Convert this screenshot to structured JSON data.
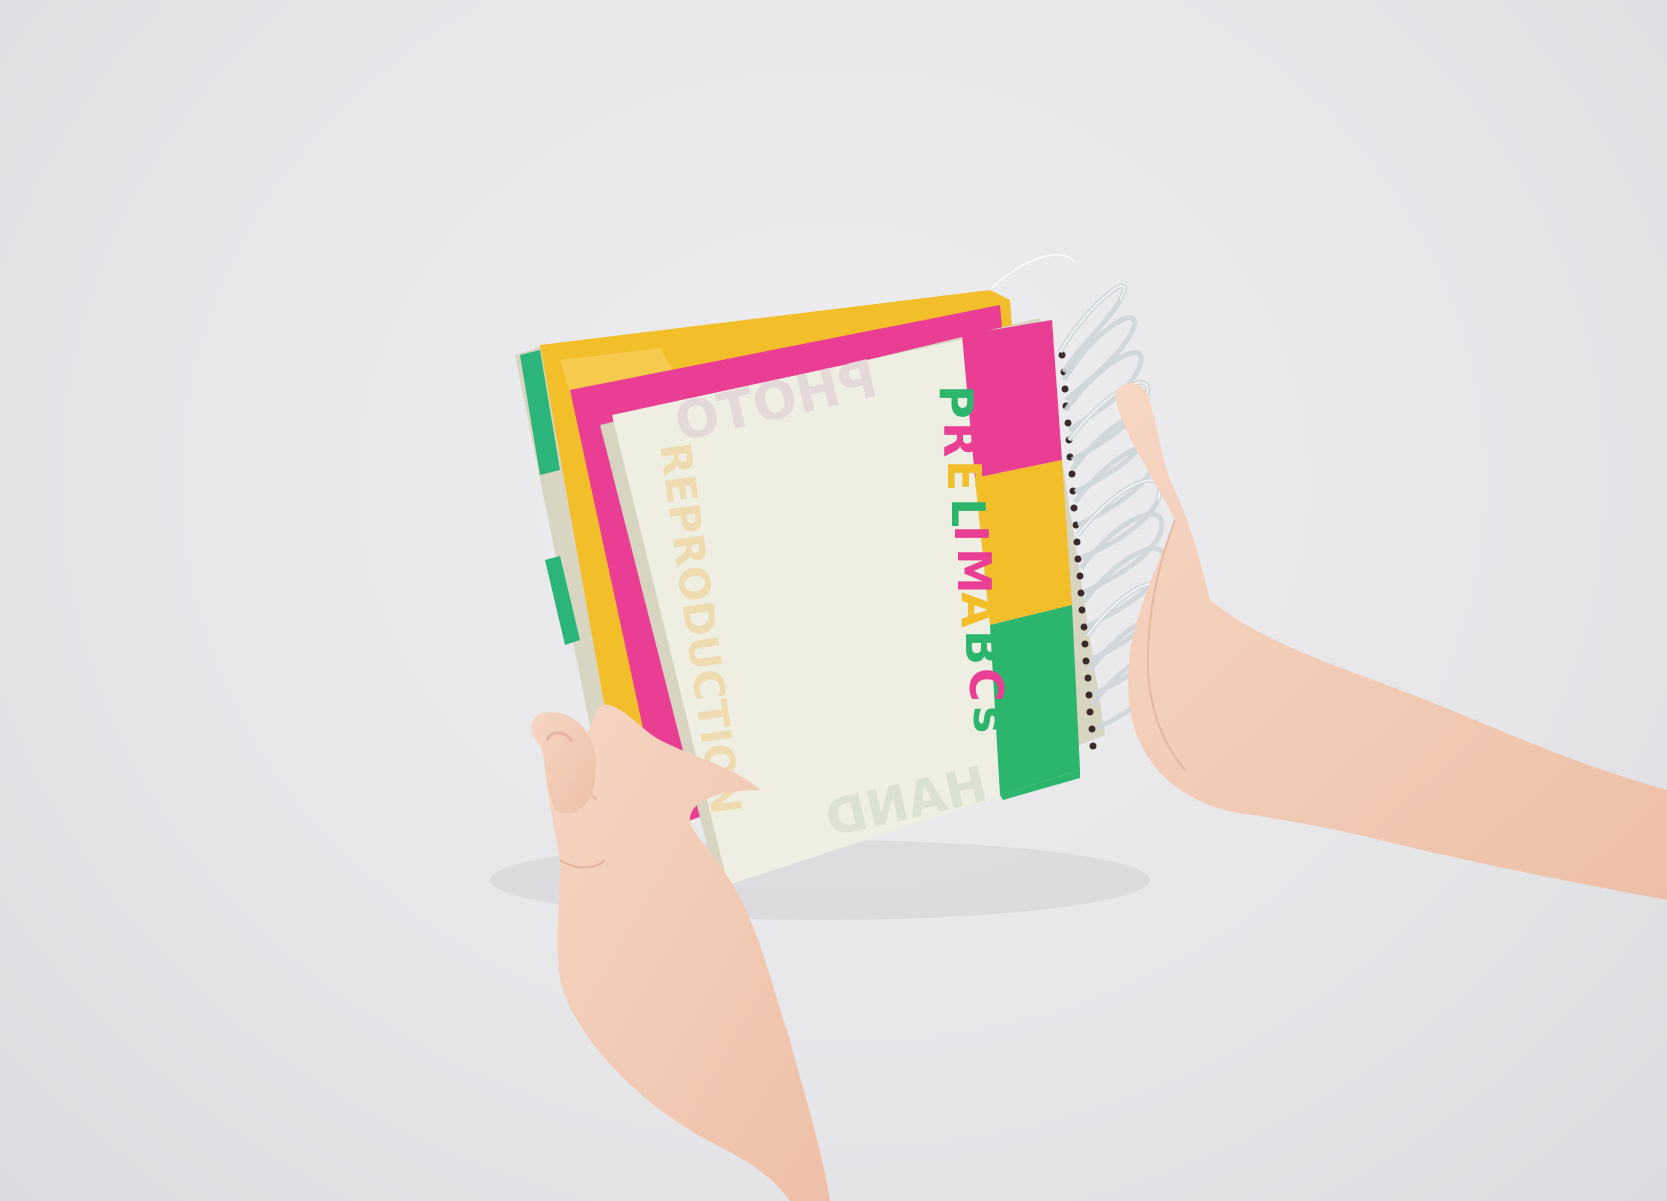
{
  "scene": {
    "description_colors": {
      "background": "#e7e7ea",
      "cover": "#efeee2",
      "yellow": "#f2be2a",
      "pink": "#ea3e95",
      "green": "#2cb56d",
      "skin": "#f3cdb8"
    }
  },
  "book": {
    "title_letters": [
      "P",
      "R",
      "E",
      "L",
      "I",
      "M",
      "A",
      "B",
      "C",
      "s"
    ],
    "faint_word_top": "PHOTO",
    "faint_word_side": "REPRODUCTION",
    "faint_word_bottom": "HAND",
    "letter_colors": [
      "#2cb56d",
      "#ea3e95",
      "#f2be2a",
      "#2cb56d",
      "#ea3e95",
      "#ea3e95",
      "#f2be2a",
      "#2cb56d",
      "#ea3e95",
      "#2cb56d"
    ]
  }
}
